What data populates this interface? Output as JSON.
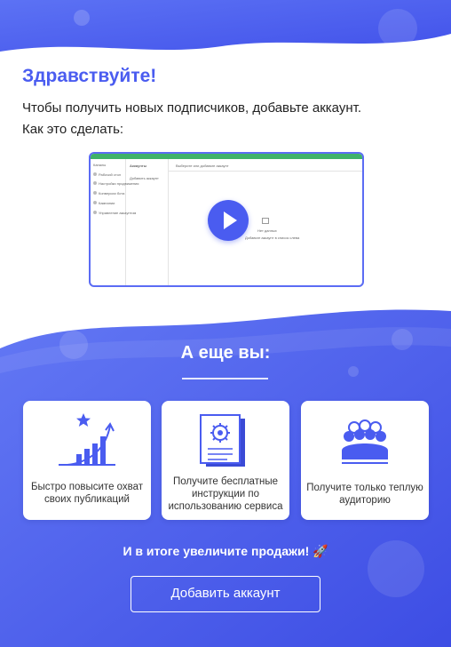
{
  "greeting": "Здравствуйте!",
  "intro_line_1": "Чтобы получить новых подписчиков, добавьте аккаунт.",
  "intro_line_2": "Как это сделать:",
  "video_preview": {
    "side_items": [
      "Каналы",
      "Рабочий стол",
      "Настройки продвижения",
      "Конверсии бота",
      "Кампании",
      "Управление аккаунтом"
    ],
    "mid_label": "Аккаунты",
    "mid_item": "Добавить аккаунт",
    "header_label": "Выберите или добавьте аккаунт",
    "empty_title": "Нет данных",
    "empty_hint": "Добавьте аккаунт в список слева",
    "play_icon": "play-icon"
  },
  "section_title": "А еще вы:",
  "cards": [
    {
      "icon": "growth-chart-icon",
      "text": "Быстро повысите охват своих публикаций"
    },
    {
      "icon": "instructions-document-icon",
      "text": "Получите бесплатные инструкции по использованию сервиса"
    },
    {
      "icon": "audience-group-icon",
      "text": "Получите только теплую аудиторию"
    }
  ],
  "final_text": "И в итоге увеличите продажи!",
  "final_emoji": "🚀",
  "cta_label": "Добавить аккаунт",
  "colors": {
    "accent": "#4a5cf0",
    "background_gradient": [
      "#5e73f4",
      "#3f4fe6"
    ],
    "preview_top_bar": "#3fb26a",
    "white": "#ffffff"
  }
}
